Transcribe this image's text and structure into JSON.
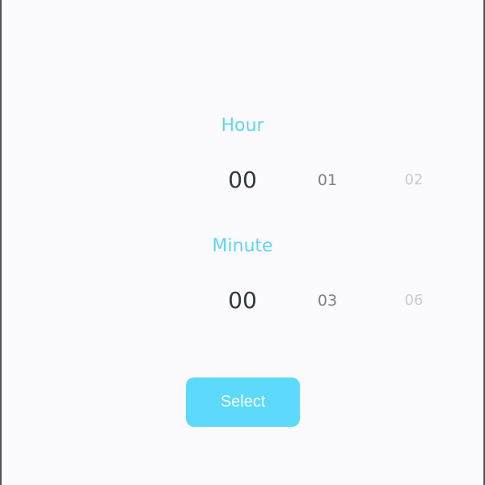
{
  "hour": {
    "label": "Hour",
    "selected": "00",
    "options": [
      "01",
      "02"
    ]
  },
  "minute": {
    "label": "Minute",
    "selected": "00",
    "options": [
      "03",
      "06"
    ]
  },
  "select_button": "Select",
  "colors": {
    "accent": "#5cd9fb",
    "label": "#5fd6f2"
  }
}
